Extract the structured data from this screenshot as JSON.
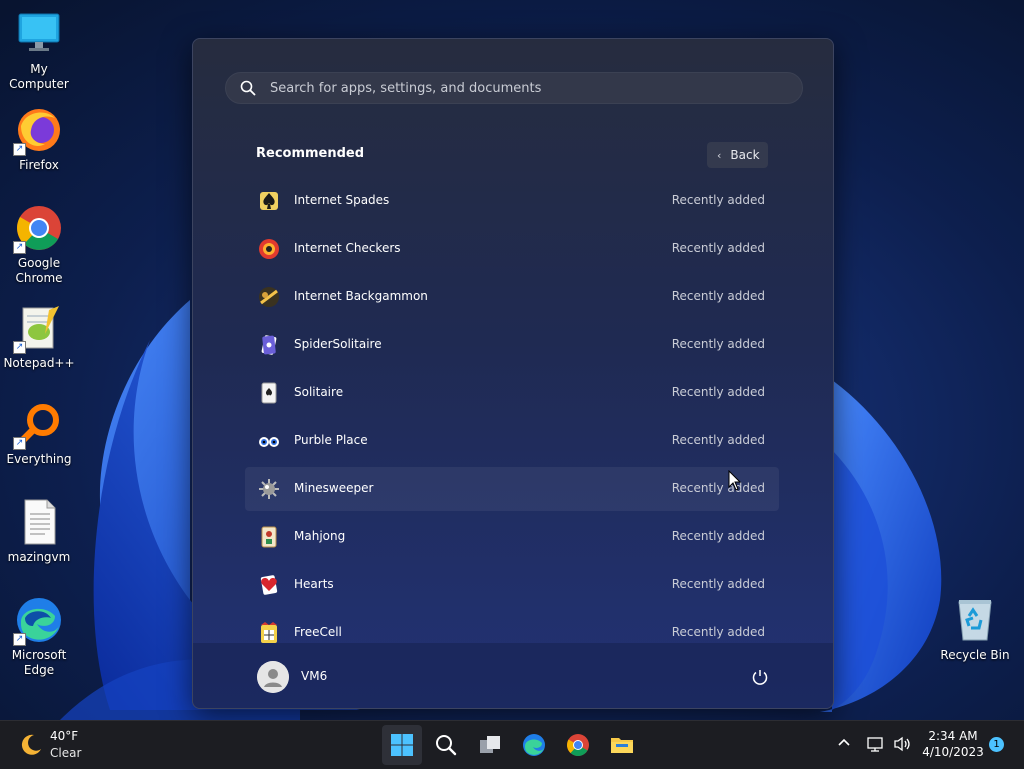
{
  "desktop": {
    "icons": [
      {
        "label": "My Computer"
      },
      {
        "label": "Firefox"
      },
      {
        "label": "Google Chrome"
      },
      {
        "label": "Notepad++"
      },
      {
        "label": "Everything"
      },
      {
        "label": "mazingvm"
      },
      {
        "label": "Microsoft Edge"
      },
      {
        "label": "Recycle Bin"
      }
    ]
  },
  "start_menu": {
    "search_placeholder": "Search for apps, settings, and documents",
    "section_title": "Recommended",
    "back_label": "Back",
    "items": [
      {
        "name": "Internet Spades",
        "sub": "Recently added"
      },
      {
        "name": "Internet Checkers",
        "sub": "Recently added"
      },
      {
        "name": "Internet Backgammon",
        "sub": "Recently added"
      },
      {
        "name": "SpiderSolitaire",
        "sub": "Recently added"
      },
      {
        "name": "Solitaire",
        "sub": "Recently added"
      },
      {
        "name": "Purble Place",
        "sub": "Recently added"
      },
      {
        "name": "Minesweeper",
        "sub": "Recently added"
      },
      {
        "name": "Mahjong",
        "sub": "Recently added"
      },
      {
        "name": "Hearts",
        "sub": "Recently added"
      },
      {
        "name": "FreeCell",
        "sub": "Recently added"
      }
    ],
    "user_name": "VM6"
  },
  "taskbar": {
    "weather_temp": "40°F",
    "weather_cond": "Clear",
    "time": "2:34 AM",
    "date": "4/10/2023",
    "notification_count": "1"
  },
  "colors": {
    "accent": "#4cc2ff",
    "start_bg": "#1f2a52",
    "taskbar_bg": "#1c1d22"
  }
}
